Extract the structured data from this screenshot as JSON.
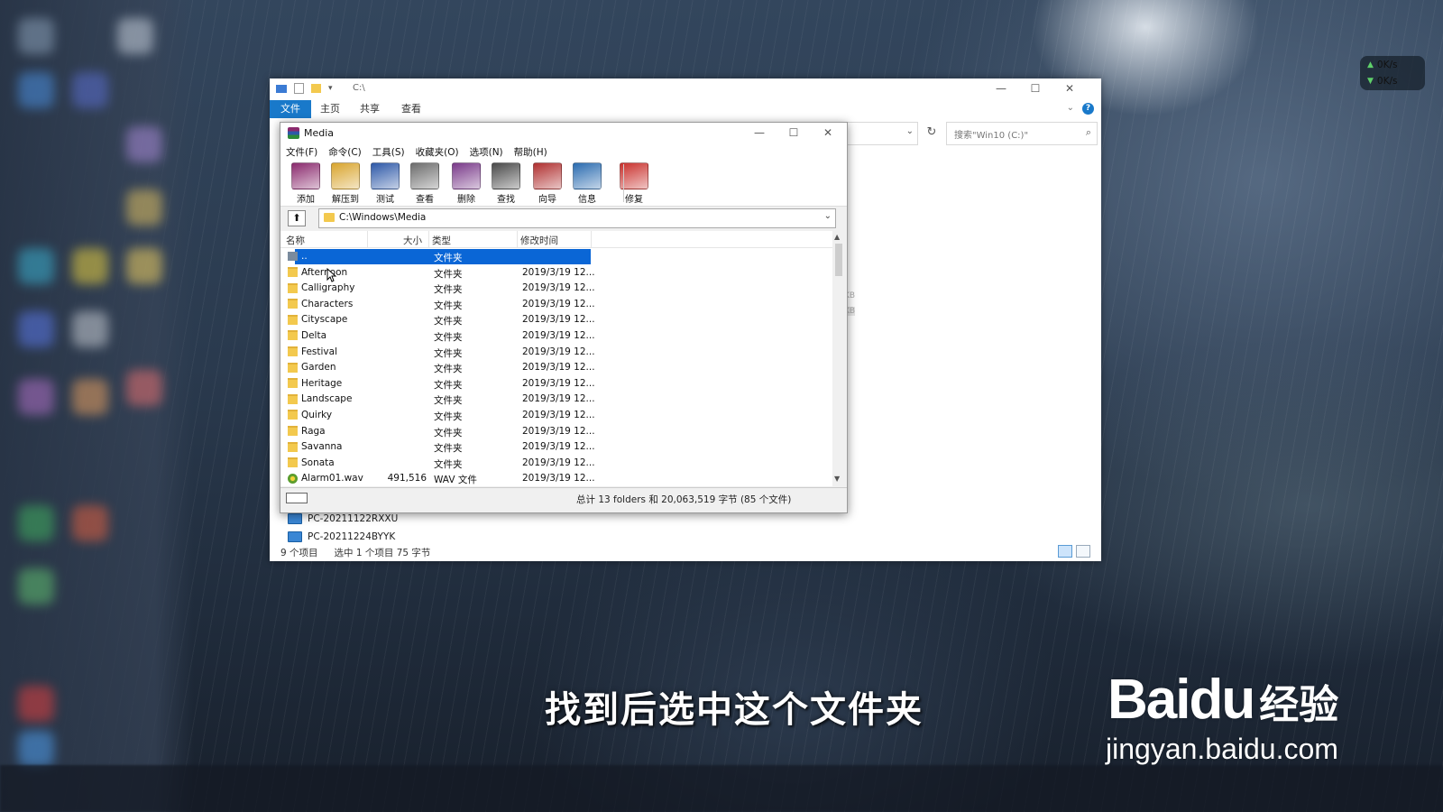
{
  "explorer": {
    "path": "C:\\",
    "tabs": [
      "文件",
      "主页",
      "共享",
      "查看"
    ],
    "search_placeholder": "搜索\"Win10 (C:)\"",
    "tree": [
      "PC-20211122RXXU",
      "PC-20211224BYYK"
    ],
    "status_items": "9 个项目",
    "status_selected": "选中 1 个项目  75 字节",
    "frag1": "KB",
    "frag2": "KB"
  },
  "winrar": {
    "title": "Media",
    "menu": [
      "文件(F)",
      "命令(C)",
      "工具(S)",
      "收藏夹(O)",
      "选项(N)",
      "帮助(H)"
    ],
    "toolbar": [
      {
        "label": "添加",
        "icon": "add-archive-icon",
        "color": "#8b2a6e"
      },
      {
        "label": "解压到",
        "icon": "extract-to-icon",
        "color": "#d9a52e"
      },
      {
        "label": "测试",
        "icon": "test-icon",
        "color": "#2e59a8"
      },
      {
        "label": "查看",
        "icon": "view-icon",
        "color": "#6d6d6d"
      },
      {
        "label": "删除",
        "icon": "delete-icon",
        "color": "#7a3a8a"
      },
      {
        "label": "查找",
        "icon": "find-icon",
        "color": "#4a4a4a"
      },
      {
        "label": "向导",
        "icon": "wizard-icon",
        "color": "#b03030"
      },
      {
        "label": "信息",
        "icon": "info-icon",
        "color": "#2b6cb0"
      },
      {
        "label": "修复",
        "icon": "repair-icon",
        "color": "#c9302c"
      }
    ],
    "address": "C:\\Windows\\Media",
    "columns": {
      "name": "名称",
      "size": "大小",
      "type": "类型",
      "modified": "修改时间"
    },
    "rows": [
      {
        "name": "..",
        "size": "",
        "type": "文件夹",
        "modified": "",
        "kind": "up",
        "selected": true
      },
      {
        "name": "Afternoon",
        "size": "",
        "type": "文件夹",
        "modified": "2019/3/19 12...",
        "kind": "folder"
      },
      {
        "name": "Calligraphy",
        "size": "",
        "type": "文件夹",
        "modified": "2019/3/19 12...",
        "kind": "folder"
      },
      {
        "name": "Characters",
        "size": "",
        "type": "文件夹",
        "modified": "2019/3/19 12...",
        "kind": "folder"
      },
      {
        "name": "Cityscape",
        "size": "",
        "type": "文件夹",
        "modified": "2019/3/19 12...",
        "kind": "folder"
      },
      {
        "name": "Delta",
        "size": "",
        "type": "文件夹",
        "modified": "2019/3/19 12...",
        "kind": "folder"
      },
      {
        "name": "Festival",
        "size": "",
        "type": "文件夹",
        "modified": "2019/3/19 12...",
        "kind": "folder"
      },
      {
        "name": "Garden",
        "size": "",
        "type": "文件夹",
        "modified": "2019/3/19 12...",
        "kind": "folder"
      },
      {
        "name": "Heritage",
        "size": "",
        "type": "文件夹",
        "modified": "2019/3/19 12...",
        "kind": "folder"
      },
      {
        "name": "Landscape",
        "size": "",
        "type": "文件夹",
        "modified": "2019/3/19 12...",
        "kind": "folder"
      },
      {
        "name": "Quirky",
        "size": "",
        "type": "文件夹",
        "modified": "2019/3/19 12...",
        "kind": "folder"
      },
      {
        "name": "Raga",
        "size": "",
        "type": "文件夹",
        "modified": "2019/3/19 12...",
        "kind": "folder"
      },
      {
        "name": "Savanna",
        "size": "",
        "type": "文件夹",
        "modified": "2019/3/19 12...",
        "kind": "folder"
      },
      {
        "name": "Sonata",
        "size": "",
        "type": "文件夹",
        "modified": "2019/3/19 12...",
        "kind": "folder"
      },
      {
        "name": "Alarm01.wav",
        "size": "491,516",
        "type": "WAV 文件",
        "modified": "2019/3/19 12...",
        "kind": "wav"
      }
    ],
    "status": "总计 13 folders 和 20,063,519 字节 (85 个文件)"
  },
  "overlay": {
    "caption": "找到后选中这个文件夹",
    "watermark_logo": "Bai",
    "watermark_du": "du",
    "watermark_sub": "经验",
    "watermark_url": "jingyan.baidu.com"
  },
  "netwidget": {
    "up": "0K/s",
    "down": "0K/s"
  }
}
